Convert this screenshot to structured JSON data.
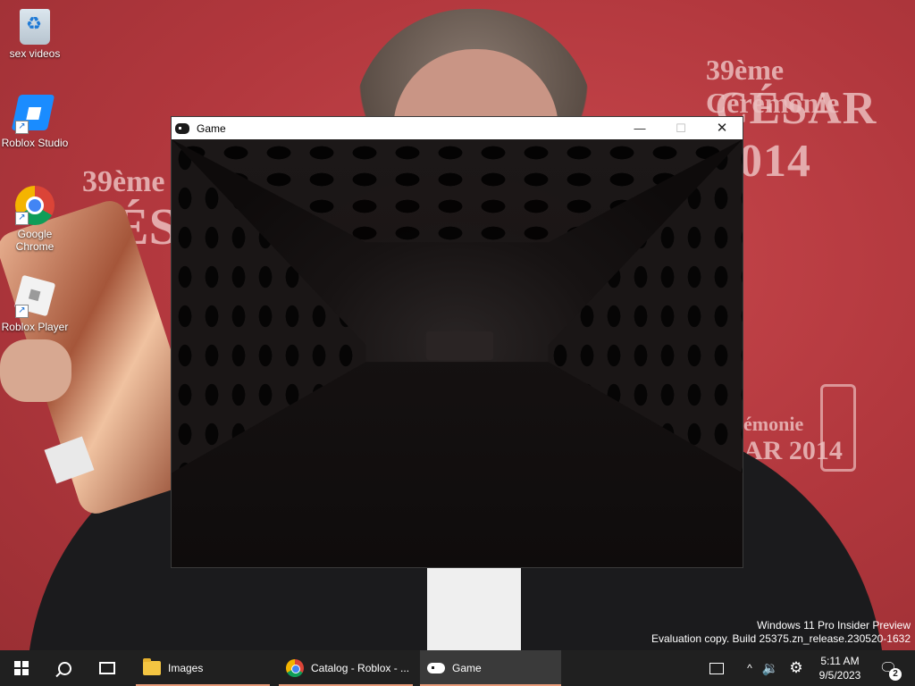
{
  "desktop": {
    "icons": [
      {
        "label": "sex videos",
        "icon": "recycle-bin-icon"
      },
      {
        "label": "Roblox Studio",
        "icon": "roblox-studio-icon"
      },
      {
        "label": "Google Chrome",
        "icon": "chrome-icon"
      },
      {
        "label": "Roblox Player",
        "icon": "roblox-player-icon"
      }
    ],
    "wallpaper_text": {
      "top_right_1": "39ème Cérémonie",
      "top_right_2": "CÉSAR 2014",
      "left_1": "39ème Cé",
      "left_2": "CÉS",
      "bottom_right_1": "émonie",
      "bottom_right_2": "AR 2014"
    }
  },
  "window": {
    "title": "Game",
    "icon": "gamepad-icon",
    "minimize_glyph": "—",
    "maximize_glyph": "☐",
    "close_glyph": "✕"
  },
  "watermark": {
    "line1": "Windows 11 Pro Insider Preview",
    "line2": "Evaluation copy. Build 25375.zn_release.230520-1632"
  },
  "taskbar": {
    "apps": [
      {
        "label": "Images",
        "icon": "folder-icon",
        "active": false
      },
      {
        "label": "Catalog - Roblox - ...",
        "icon": "chrome-icon",
        "active": false
      },
      {
        "label": "Game",
        "icon": "gamepad-icon",
        "active": true
      }
    ],
    "tray": {
      "chevron": "^",
      "volume": "🔉",
      "settings": "⚙",
      "time": "5:11 AM",
      "date": "9/5/2023",
      "notification_glyph": "🗨",
      "notification_count": "2"
    },
    "accent_color": "#e79a78"
  }
}
